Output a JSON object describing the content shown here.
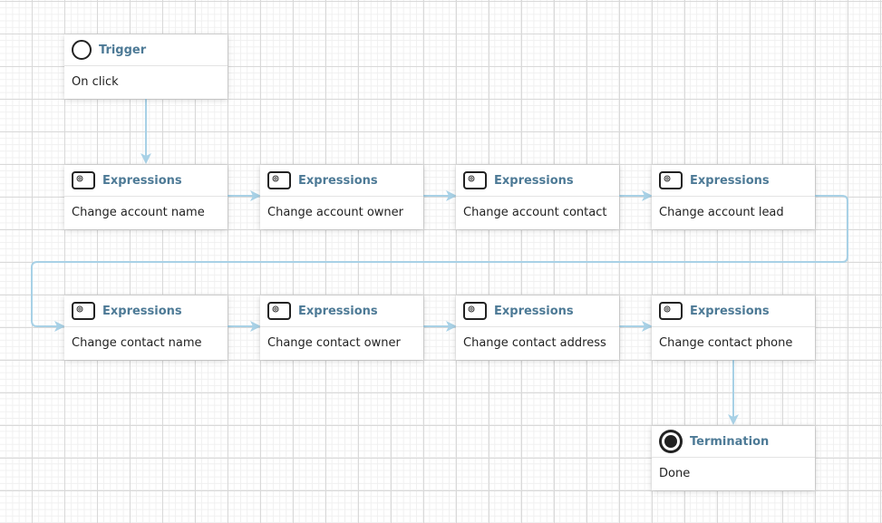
{
  "diagram": {
    "nodes": [
      {
        "id": "trigger",
        "type": "start",
        "icon": "start-event-icon",
        "title": "Trigger",
        "label": "On click"
      },
      {
        "id": "e1",
        "type": "expression",
        "icon": "gear-task-icon",
        "title": "Expressions",
        "label": "Change account name"
      },
      {
        "id": "e2",
        "type": "expression",
        "icon": "gear-task-icon",
        "title": "Expressions",
        "label": "Change account owner"
      },
      {
        "id": "e3",
        "type": "expression",
        "icon": "gear-task-icon",
        "title": "Expressions",
        "label": "Change account contact"
      },
      {
        "id": "e4",
        "type": "expression",
        "icon": "gear-task-icon",
        "title": "Expressions",
        "label": "Change account lead"
      },
      {
        "id": "e5",
        "type": "expression",
        "icon": "gear-task-icon",
        "title": "Expressions",
        "label": "Change contact name"
      },
      {
        "id": "e6",
        "type": "expression",
        "icon": "gear-task-icon",
        "title": "Expressions",
        "label": "Change contact owner"
      },
      {
        "id": "e7",
        "type": "expression",
        "icon": "gear-task-icon",
        "title": "Expressions",
        "label": "Change contact address"
      },
      {
        "id": "e8",
        "type": "expression",
        "icon": "gear-task-icon",
        "title": "Expressions",
        "label": "Change contact phone"
      },
      {
        "id": "end",
        "type": "end",
        "icon": "end-event-icon",
        "title": "Termination",
        "label": "Done"
      }
    ],
    "edges": [
      {
        "from": "trigger",
        "to": "e1"
      },
      {
        "from": "e1",
        "to": "e2"
      },
      {
        "from": "e2",
        "to": "e3"
      },
      {
        "from": "e3",
        "to": "e4"
      },
      {
        "from": "e4",
        "to": "e5"
      },
      {
        "from": "e5",
        "to": "e6"
      },
      {
        "from": "e6",
        "to": "e7"
      },
      {
        "from": "e7",
        "to": "e8"
      },
      {
        "from": "e8",
        "to": "end"
      }
    ],
    "colors": {
      "edge": "#a8d1e6",
      "title": "#4d7a96",
      "text": "#222222"
    }
  }
}
